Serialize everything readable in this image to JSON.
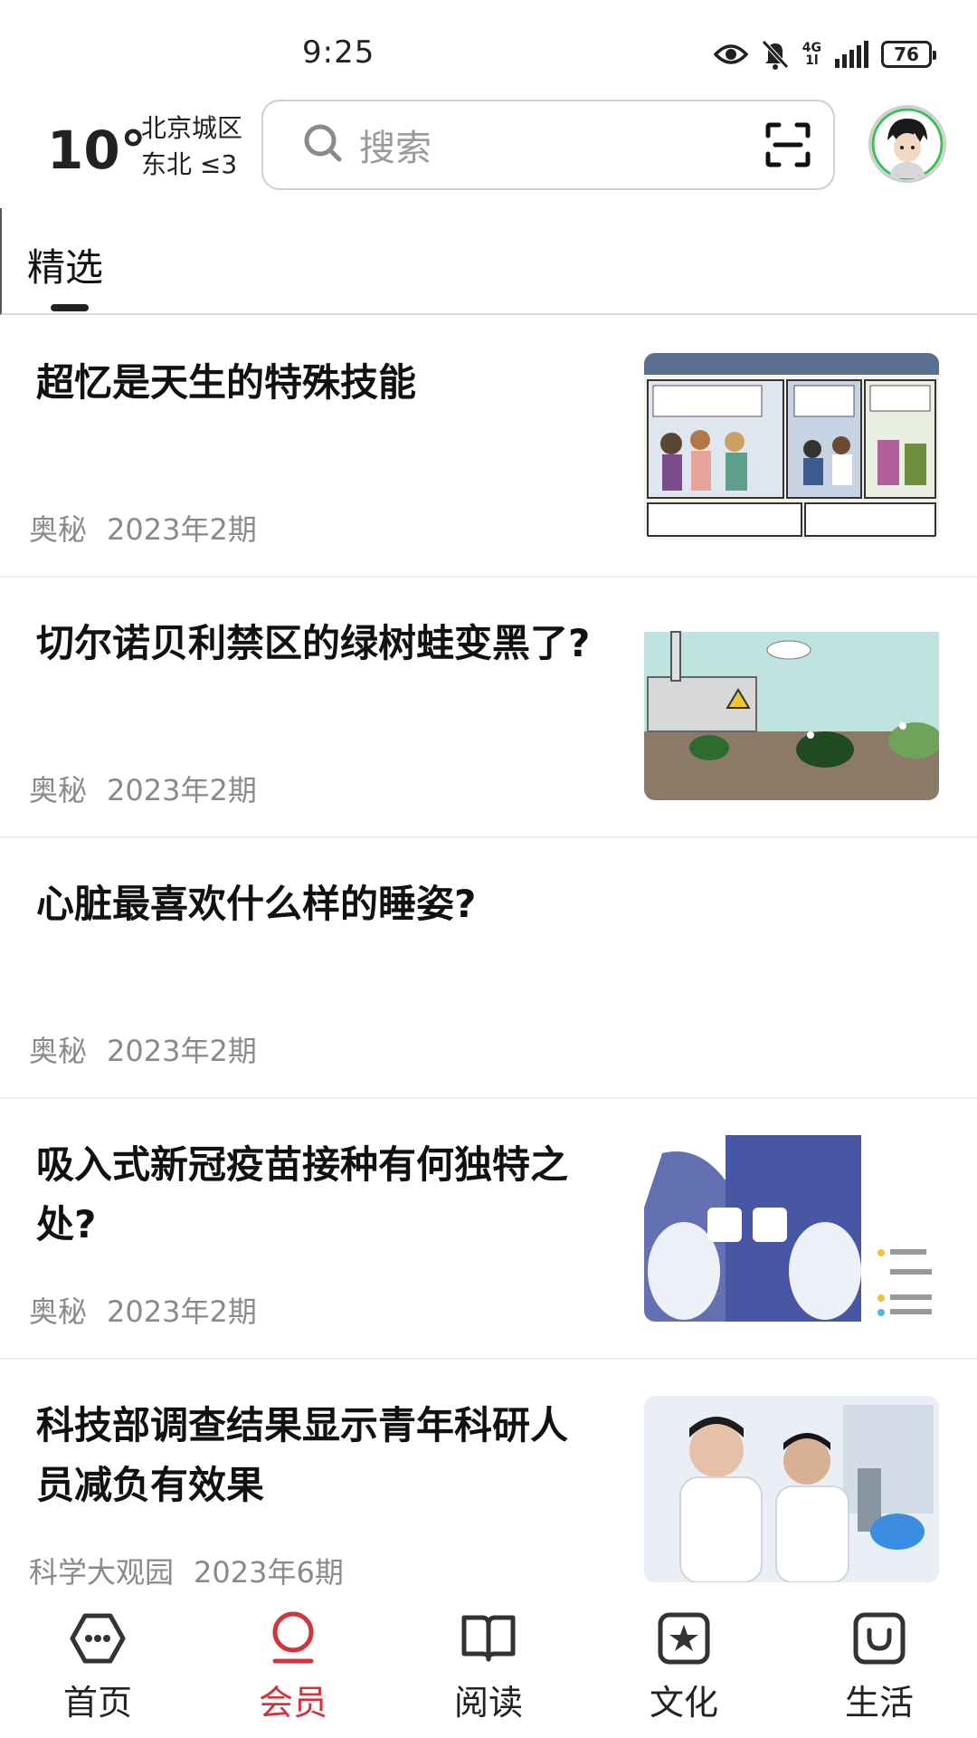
{
  "status_bar": {
    "time": "9:25",
    "network_label_top": "4G",
    "network_label_bottom": "1l",
    "battery": "76",
    "icons": [
      "eye-icon",
      "bell-off-icon",
      "signal-icon",
      "battery-icon"
    ]
  },
  "header": {
    "temperature": "10°",
    "location": "北京城区",
    "wind": "东北  ≤3",
    "search_placeholder": "搜索"
  },
  "tabs": [
    {
      "label": "精选",
      "selected": true
    }
  ],
  "articles": [
    {
      "title": "超忆是天生的特殊技能",
      "source": "奥秘",
      "issue": "2023年2期",
      "thumbnail": "comic-panels-image"
    },
    {
      "title": "切尔诺贝利禁区的绿树蛙变黑了?",
      "source": "奥秘",
      "issue": "2023年2期",
      "thumbnail": "frogs-chernobyl-image"
    },
    {
      "title": "心脏最喜欢什么样的睡姿?",
      "source": "奥秘",
      "issue": "2023年2期",
      "thumbnail": null
    },
    {
      "title": "吸入式新冠疫苗接种有何独特之处?",
      "source": "奥秘",
      "issue": "2023年2期",
      "thumbnail": "vaccine-diagram-image"
    },
    {
      "title": "科技部调查结果显示青年科研人员减负有效果",
      "source": "科学大观园",
      "issue": "2023年6期",
      "thumbnail": "researchers-lab-image"
    }
  ],
  "bottom_nav": [
    {
      "label": "首页",
      "icon": "home-icon",
      "active": false
    },
    {
      "label": "会员",
      "icon": "member-icon",
      "active": true
    },
    {
      "label": "阅读",
      "icon": "book-icon",
      "active": false
    },
    {
      "label": "文化",
      "icon": "culture-star-icon",
      "active": false
    },
    {
      "label": "生活",
      "icon": "life-icon",
      "active": false
    }
  ],
  "colors": {
    "accent": "#d2343c",
    "text": "#111111",
    "meta": "#8a8a8a",
    "divider": "#efefef"
  }
}
